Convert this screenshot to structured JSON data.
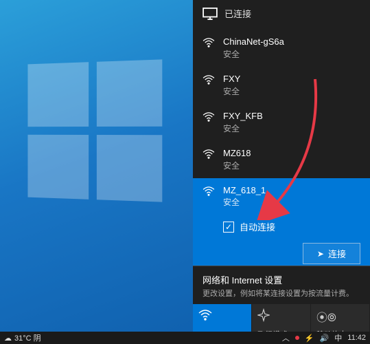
{
  "header": {
    "connected_label": "已连接"
  },
  "networks": [
    {
      "name": "ChinaNet-gS6a",
      "status": "安全"
    },
    {
      "name": "FXY",
      "status": "安全"
    },
    {
      "name": "FXY_KFB",
      "status": "安全"
    },
    {
      "name": "MZ618",
      "status": "安全"
    },
    {
      "name": "MZ_618_1",
      "status": "安全"
    }
  ],
  "selected": {
    "auto_connect_label": "自动连接",
    "auto_connect_checked": true,
    "connect_button_label": "连接"
  },
  "settings": {
    "title": "网络和 Internet 设置",
    "description": "更改设置，例如将某连接设置为按流量计费。"
  },
  "actions": {
    "wlan": "WLAN",
    "airplane": "飞行模式",
    "hotspot": "移动热点"
  },
  "taskbar": {
    "weather": "31°C 阴",
    "ime": "中",
    "time": "11:42"
  }
}
